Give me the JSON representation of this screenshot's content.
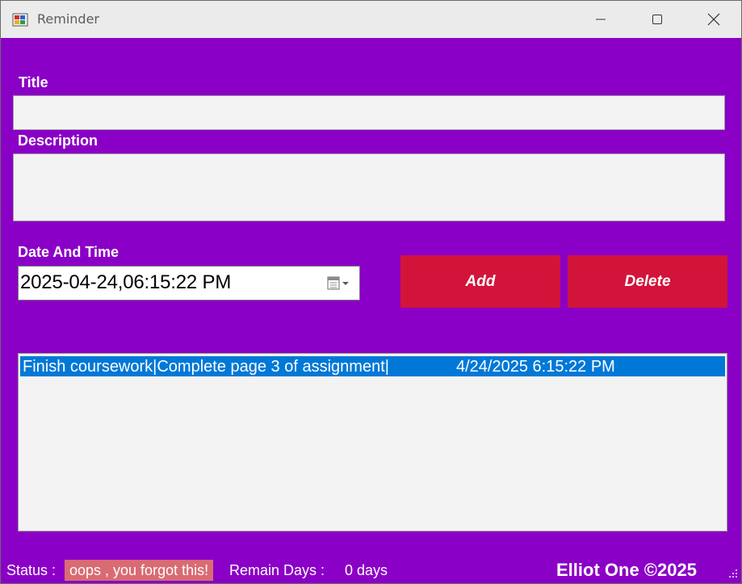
{
  "window": {
    "title": "Reminder",
    "icon": "app-icon",
    "controls": [
      "minimize-icon",
      "maximize-icon",
      "close-icon"
    ]
  },
  "form": {
    "title_label": "Title",
    "title_value": "",
    "description_label": "Description",
    "description_value": "",
    "datetime_label": "Date And Time",
    "datetime_value": "2025-04-24,06:15:22 PM",
    "calendar_icon": "calendar-dropdown-icon"
  },
  "buttons": {
    "add_label": "Add",
    "delete_label": "Delete"
  },
  "reminders": [
    {
      "text": "Finish coursework|Complete page 3 of assignment|",
      "date": "4/24/2025 6:15:22 PM",
      "selected": true
    }
  ],
  "status": {
    "label": "Status :",
    "message": "oops , you forgot this!",
    "remain_label": "Remain Days :",
    "remain_value": "0 days",
    "brand": "Elliot One ©2025"
  },
  "colors": {
    "background": "#8b00c6",
    "button": "#d2143a",
    "selection": "#0078d7",
    "status_badge": "#d96b72"
  }
}
